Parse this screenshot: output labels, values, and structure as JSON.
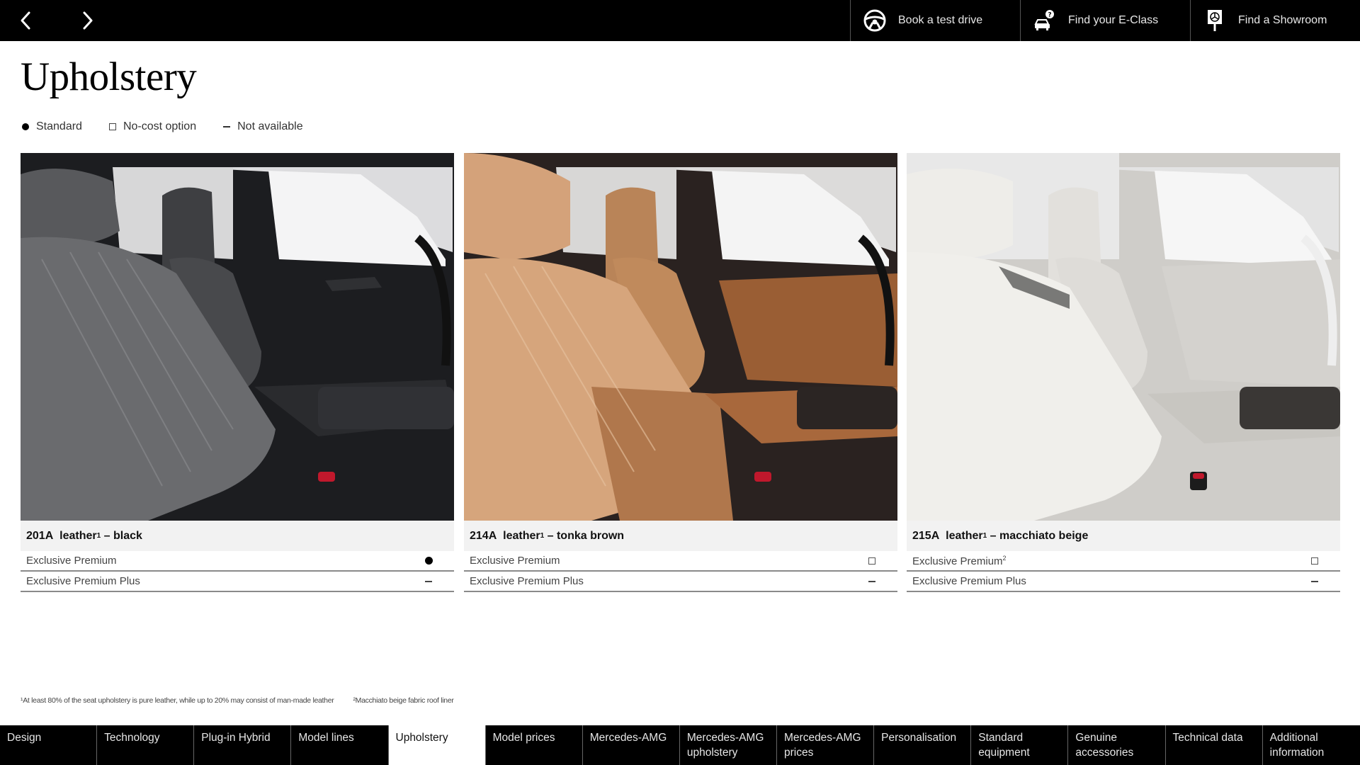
{
  "header": {
    "prev_label": "Previous page",
    "next_label": "Next page",
    "actions": [
      {
        "label": "Book a test drive",
        "icon": "steering-wheel-icon"
      },
      {
        "label": "Find your E-Class",
        "icon": "car-question-icon"
      },
      {
        "label": "Find a Showroom",
        "icon": "showroom-sign-icon"
      }
    ]
  },
  "page": {
    "title": "Upholstery"
  },
  "legend": [
    {
      "symbol": "filled-dot",
      "label": "Standard"
    },
    {
      "symbol": "empty-square",
      "label": "No-cost option"
    },
    {
      "symbol": "dash",
      "label": "Not available"
    }
  ],
  "cards": [
    {
      "code": "201A",
      "material": "leather",
      "material_footnote": "1",
      "color": "black",
      "image_description": "Black leather interior front seats",
      "rows": [
        {
          "label": "Exclusive Premium",
          "label_footnote": "",
          "availability": "standard"
        },
        {
          "label": "Exclusive Premium Plus",
          "label_footnote": "",
          "availability": "not-available"
        }
      ]
    },
    {
      "code": "214A",
      "material": "leather",
      "material_footnote": "1",
      "color": "tonka brown",
      "image_description": "Tonka brown leather interior front seats",
      "rows": [
        {
          "label": "Exclusive Premium",
          "label_footnote": "",
          "availability": "no-cost-option"
        },
        {
          "label": "Exclusive Premium Plus",
          "label_footnote": "",
          "availability": "not-available"
        }
      ]
    },
    {
      "code": "215A",
      "material": "leather",
      "material_footnote": "1",
      "color": "macchiato beige",
      "image_description": "Macchiato beige leather interior front seats",
      "rows": [
        {
          "label": "Exclusive Premium",
          "label_footnote": "2",
          "availability": "no-cost-option"
        },
        {
          "label": "Exclusive Premium Plus",
          "label_footnote": "",
          "availability": "not-available"
        }
      ]
    }
  ],
  "footnotes": [
    "¹At least 80% of the seat upholstery is pure leather, while up to 20% may consist of man-made leather",
    "²Macchiato beige fabric roof liner"
  ],
  "bottom_nav": {
    "active_index": 4,
    "tabs": [
      "Design",
      "Technology",
      "Plug-in Hybrid",
      "Model lines",
      "Upholstery",
      "Model prices",
      "Mercedes-AMG",
      "Mercedes-AMG upholstery",
      "Mercedes-AMG prices",
      "Personalisation",
      "Standard equipment",
      "Genuine accessories",
      "Technical data",
      "Additional information"
    ]
  },
  "colors": {
    "header_bg": "#000000",
    "nav_bg": "#000000",
    "active_tab_bg": "#ffffff",
    "caption_bg": "#f2f2f2",
    "seat_black": "#4a4a4c",
    "seat_tonka_brown": "#c8956a",
    "seat_macchiato_beige": "#e6e4df"
  }
}
